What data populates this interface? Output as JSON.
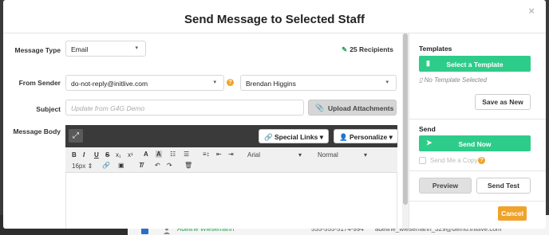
{
  "modal": {
    "title": "Send Message to Selected Staff",
    "close_glyph": "×"
  },
  "form": {
    "message_type": {
      "label": "Message Type",
      "value": "Email"
    },
    "recipients": {
      "icon": "pencil-icon",
      "text": "25 Recipients"
    },
    "from_sender": {
      "label": "From Sender",
      "email_value": "do-not-reply@initlive.com",
      "name_value": "Brendan Higgins",
      "info_badge": "?"
    },
    "subject": {
      "label": "Subject",
      "placeholder": "Update from G4G Demo"
    },
    "upload_label": "Upload Attachments",
    "message_body_label": "Message Body"
  },
  "editor": {
    "special_links": "Special Links",
    "personalize": "Personalize",
    "toolbar": {
      "bold": "B",
      "italic": "I",
      "underline": "U",
      "strike": "S",
      "subscript": "x₁",
      "superscript": "x¹",
      "font": "Arial",
      "style": "Normal",
      "size": "16px"
    }
  },
  "templates": {
    "title": "Templates",
    "select_label": "Select a Template",
    "none_selected": "No Template Selected",
    "save_as_new": "Save as New"
  },
  "send": {
    "title": "Send",
    "send_now": "Send Now",
    "send_me_copy": "Send Me a Copy",
    "info_badge": "?",
    "preview": "Preview",
    "send_test": "Send Test",
    "cancel": "Cancel"
  },
  "background": {
    "row_name": "Adeline Wiesemann",
    "row_phone": "555-555-5174-994",
    "row_email": "adeline_wiesemann_329@demo.initlive.com"
  },
  "colors": {
    "accent_green": "#2ecc8a",
    "warn_orange": "#f0a32b",
    "editor_dark": "#3a3a3a"
  }
}
